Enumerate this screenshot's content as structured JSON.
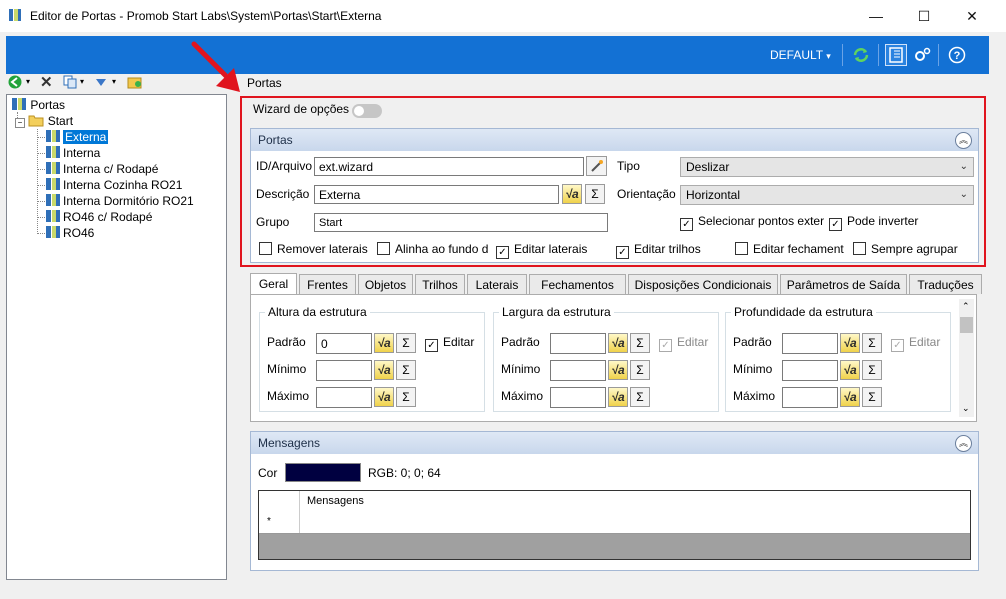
{
  "window": {
    "title": "Editor de Portas - Promob Start Labs\\System\\Portas\\Start\\Externa",
    "minimize": "—",
    "maximize": "☐",
    "close": "✕"
  },
  "bluebar": {
    "profile": "DEFAULT",
    "profile_arrow": "▾"
  },
  "tree": {
    "root": "Portas",
    "folder": "Start",
    "items": [
      "Externa",
      "Interna",
      "Interna c/ Rodapé",
      "Interna Cozinha RO21",
      "Interna Dormitório RO21",
      "RO46 c/ Rodapé",
      "RO46"
    ]
  },
  "breadcrumb": "Portas",
  "wizard": {
    "label": "Wizard de opções"
  },
  "portas_panel": {
    "header": "Portas",
    "id_label": "ID/Arquivo",
    "id_value": "ext.wizard",
    "desc_label": "Descrição",
    "desc_value": "Externa",
    "grupo_label": "Grupo",
    "grupo_value": "Start",
    "tipo_label": "Tipo",
    "tipo_value": "Deslizar",
    "orient_label": "Orientação",
    "orient_value": "Horizontal",
    "sel_pontos": "Selecionar pontos exter",
    "pode_inverter": "Pode inverter",
    "remover_laterais": "Remover laterais",
    "alinha_fundo": "Alinha ao fundo d",
    "editar_laterais": "Editar laterais",
    "editar_trilhos": "Editar trilhos",
    "editar_fechamento": "Editar fechament",
    "sempre_agrupar": "Sempre agrupar"
  },
  "tabs": [
    "Geral",
    "Frentes",
    "Objetos",
    "Trilhos",
    "Laterais",
    "Fechamentos",
    "Disposições Condicionais",
    "Parâmetros de Saída",
    "Traduções"
  ],
  "geral": {
    "altura": {
      "title": "Altura da estrutura",
      "padrao": "Padrão",
      "padrao_value": "0",
      "minimo": "Mínimo",
      "maximo": "Máximo",
      "editar": "Editar"
    },
    "largura": {
      "title": "Largura da estrutura",
      "padrao": "Padrão",
      "minimo": "Mínimo",
      "maximo": "Máximo",
      "editar": "Editar"
    },
    "profundidade": {
      "title": "Profundidade da estrutura",
      "padrao": "Padrão",
      "minimo": "Mínimo",
      "maximo": "Máximo",
      "editar": "Editar"
    }
  },
  "mensagens": {
    "header": "Mensagens",
    "cor_label": "Cor",
    "cor_swatch": "#000040",
    "rgb_text": "RGB: 0; 0; 64",
    "col_header": "Mensagens",
    "row_marker": "*"
  },
  "glyphs": {
    "fx": "√a",
    "sigma": "Σ",
    "check": "✓",
    "collapse": "︽"
  },
  "colors": {
    "accent": "#1371d4",
    "annotation": "#e0141e"
  }
}
